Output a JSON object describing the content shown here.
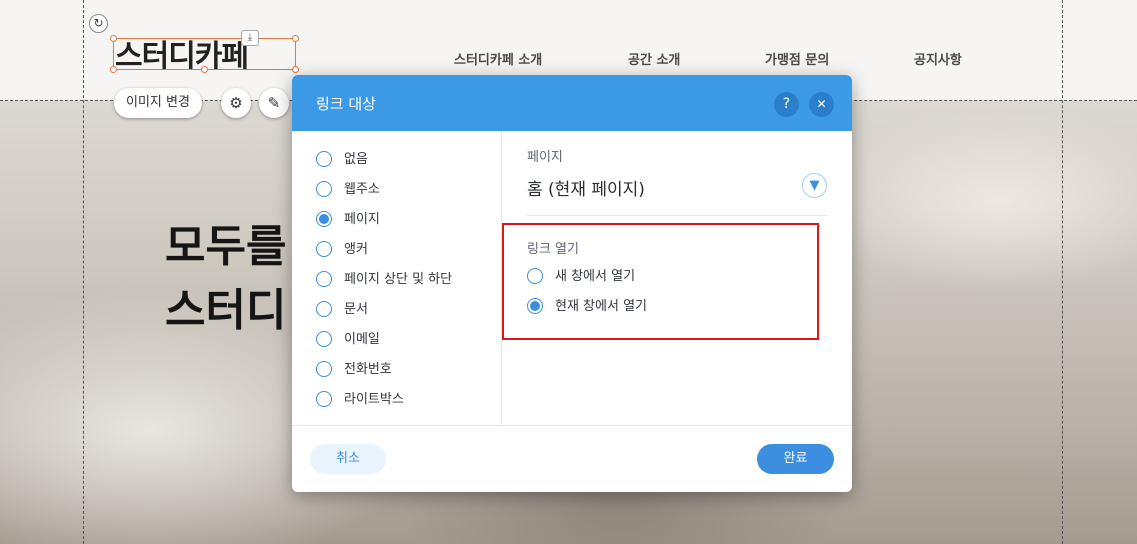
{
  "editor": {
    "logo_text": "스터디카페",
    "change_image_label": "이미지 변경",
    "settings_icon": "gear-icon",
    "design_icon": "brush-icon",
    "rotate_icon": "rotate-icon",
    "download_icon": "download-icon",
    "nav_items": [
      "스터디카페 소개",
      "공간 소개",
      "가맹점 문의",
      "공지사항"
    ],
    "hero_text": "모두를\n스터디"
  },
  "dialog": {
    "title": "링크 대상",
    "help_label": "?",
    "close_label": "✕",
    "link_types": [
      {
        "label": "없음",
        "selected": false
      },
      {
        "label": "웹주소",
        "selected": false
      },
      {
        "label": "페이지",
        "selected": true
      },
      {
        "label": "앵커",
        "selected": false
      },
      {
        "label": "페이지 상단 및 하단",
        "selected": false
      },
      {
        "label": "문서",
        "selected": false
      },
      {
        "label": "이메일",
        "selected": false
      },
      {
        "label": "전화번호",
        "selected": false
      },
      {
        "label": "라이트박스",
        "selected": false
      }
    ],
    "page_section_label": "페이지",
    "page_selected_value": "홈 (현재 페이지)",
    "link_open_label": "링크 열기",
    "open_options": [
      {
        "label": "새 창에서 열기",
        "selected": false
      },
      {
        "label": "현재 창에서 열기",
        "selected": true
      }
    ],
    "cancel_label": "취소",
    "done_label": "완료",
    "accent_color": "#3b8ee0",
    "header_color": "#3c99e6",
    "highlight_color": "#e0141c"
  }
}
